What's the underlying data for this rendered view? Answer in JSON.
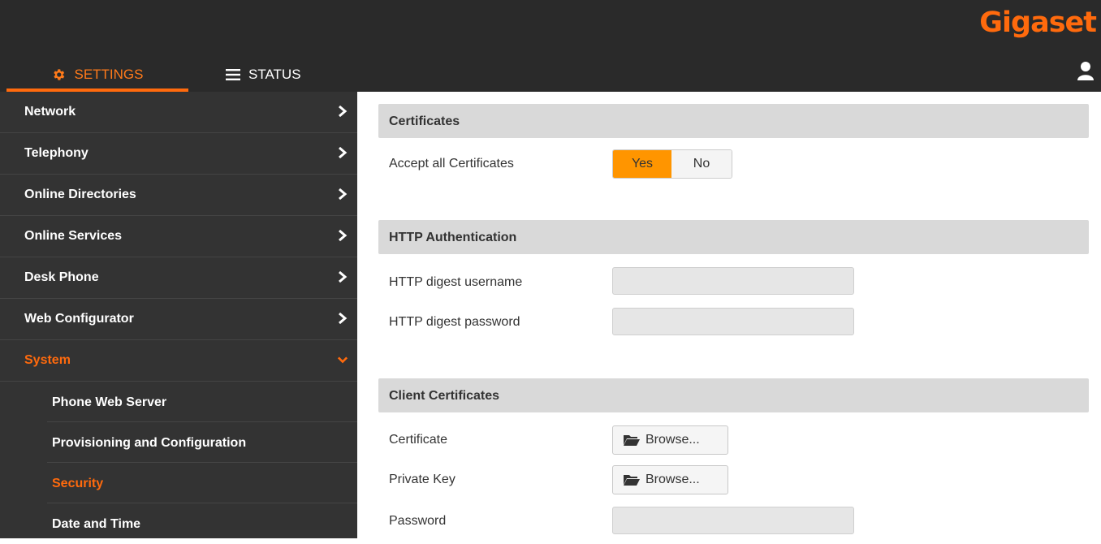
{
  "header": {
    "logo": "Gigaset",
    "tabs": [
      {
        "label": "SETTINGS",
        "icon": "gear-icon",
        "active": true
      },
      {
        "label": "STATUS",
        "icon": "menu-icon",
        "active": false
      }
    ],
    "user_icon": "user-icon"
  },
  "colors": {
    "accent": "#ff6a0d",
    "toggle_on": "#ff9500",
    "sidebar_bg": "#333333",
    "topbar_bg": "#2a2a2a"
  },
  "sidebar": {
    "items": [
      {
        "label": "Network"
      },
      {
        "label": "Telephony"
      },
      {
        "label": "Online Directories"
      },
      {
        "label": "Online Services"
      },
      {
        "label": "Desk Phone"
      },
      {
        "label": "Web Configurator"
      },
      {
        "label": "System",
        "expanded": true
      }
    ],
    "sub_items": [
      {
        "label": "Phone Web Server"
      },
      {
        "label": "Provisioning and Configuration"
      },
      {
        "label": "Security",
        "active": true
      },
      {
        "label": "Date and Time"
      }
    ]
  },
  "main": {
    "certificates": {
      "title": "Certificates",
      "accept_label": "Accept all Certificates",
      "yes": "Yes",
      "no": "No",
      "selected": "Yes"
    },
    "http_auth": {
      "title": "HTTP Authentication",
      "username_label": "HTTP digest username",
      "username_value": "",
      "password_label": "HTTP digest password",
      "password_value": ""
    },
    "client_certs": {
      "title": "Client Certificates",
      "certificate_label": "Certificate",
      "private_key_label": "Private Key",
      "browse_label": "Browse...",
      "password_label": "Password",
      "password_value": ""
    }
  }
}
